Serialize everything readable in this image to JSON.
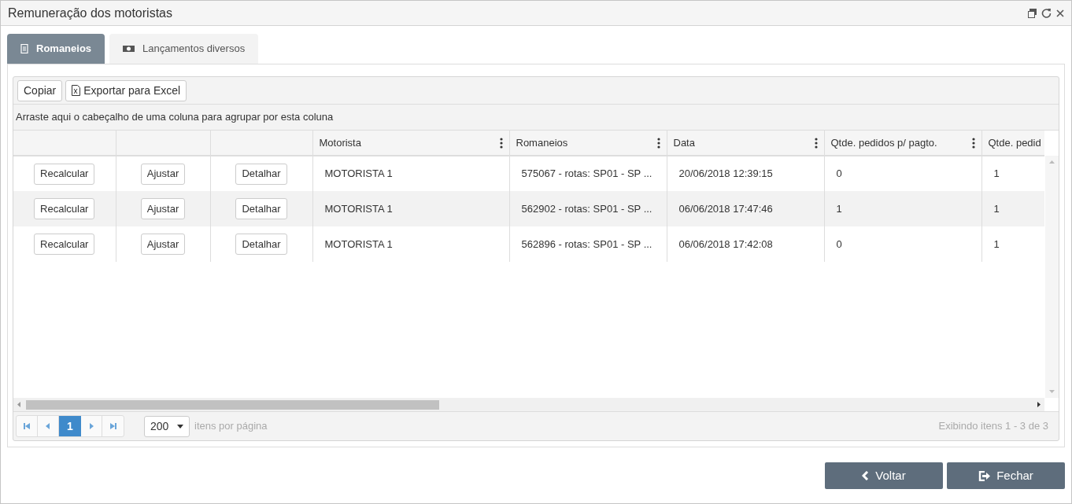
{
  "window": {
    "title": "Remuneração dos motoristas"
  },
  "tabs": [
    {
      "label": "Romaneios",
      "selected": true,
      "kind": "list"
    },
    {
      "label": "Lançamentos diversos",
      "selected": false,
      "kind": "money"
    }
  ],
  "toolbar": [
    {
      "label": "Copiar",
      "kind": "plain"
    },
    {
      "label": "Exportar para Excel",
      "kind": "excel"
    }
  ],
  "group_hint": "Arraste aqui o cabeçalho de uma coluna para agrupar por esta coluna",
  "table": {
    "columns": [
      "",
      "",
      "",
      "Motorista",
      "Romaneios",
      "Data",
      "Qtde. pedidos p/ pagto.",
      "Qtde. pedid"
    ],
    "rows": [
      {
        "cells": [
          {
            "kind": "button",
            "text": "Recalcular"
          },
          {
            "kind": "button",
            "text": "Ajustar"
          },
          {
            "kind": "button",
            "text": "Detalhar"
          },
          {
            "kind": "text",
            "text": "MOTORISTA 1"
          },
          {
            "kind": "text",
            "text": "575067 - rotas: SP01 - SP ..."
          },
          {
            "kind": "text",
            "text": "20/06/2018 12:39:15"
          },
          {
            "kind": "text",
            "text": "0"
          },
          {
            "kind": "text",
            "text": "1"
          }
        ]
      },
      {
        "cells": [
          {
            "kind": "button",
            "text": "Recalcular"
          },
          {
            "kind": "button",
            "text": "Ajustar"
          },
          {
            "kind": "button",
            "text": "Detalhar"
          },
          {
            "kind": "text",
            "text": "MOTORISTA 1"
          },
          {
            "kind": "text",
            "text": "562902 - rotas: SP01 - SP ..."
          },
          {
            "kind": "text",
            "text": "06/06/2018 17:47:46"
          },
          {
            "kind": "text",
            "text": "1"
          },
          {
            "kind": "text",
            "text": "1"
          }
        ]
      },
      {
        "cells": [
          {
            "kind": "button",
            "text": "Recalcular"
          },
          {
            "kind": "button",
            "text": "Ajustar"
          },
          {
            "kind": "button",
            "text": "Detalhar"
          },
          {
            "kind": "text",
            "text": "MOTORISTA 1"
          },
          {
            "kind": "text",
            "text": "562896 - rotas: SP01 - SP ..."
          },
          {
            "kind": "text",
            "text": "06/06/2018 17:42:08"
          },
          {
            "kind": "text",
            "text": "0"
          },
          {
            "kind": "text",
            "text": "1"
          }
        ]
      }
    ]
  },
  "pager": {
    "pages": [
      {
        "label": "1",
        "selected": true
      }
    ],
    "page_size": "200",
    "page_size_label": "itens por página",
    "summary": "Exibindo itens 1 - 3 de 3"
  },
  "footer_buttons": [
    {
      "label": "Voltar",
      "kind": "back"
    },
    {
      "label": "Fechar",
      "kind": "exit"
    }
  ]
}
